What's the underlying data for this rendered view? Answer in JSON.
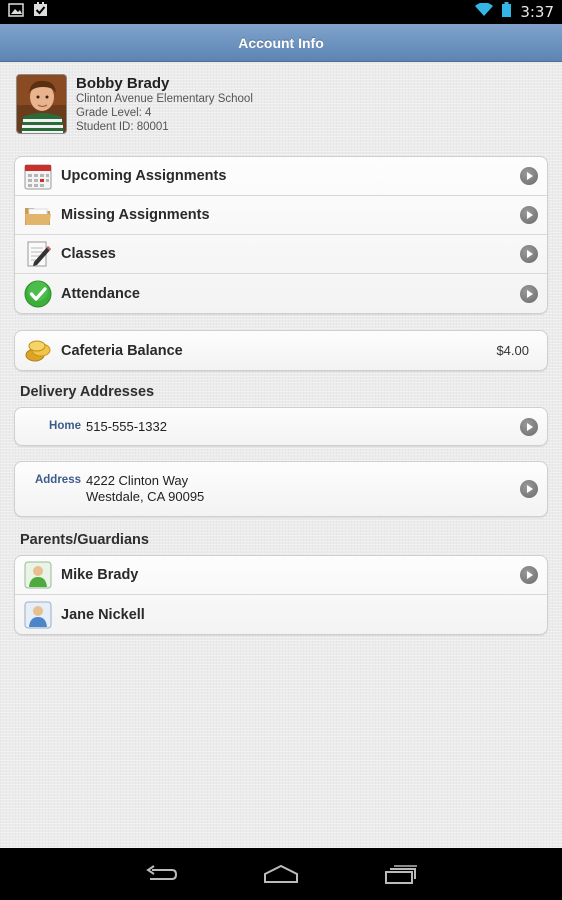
{
  "status_bar": {
    "time": "3:37",
    "left_icons": [
      "image-notification-icon",
      "checkbox-notification-icon"
    ],
    "right_icons": [
      "wifi-icon",
      "battery-icon"
    ]
  },
  "header": {
    "title": "Account Info"
  },
  "student": {
    "name": "Bobby Brady",
    "school": "Clinton Avenue Elementary School",
    "grade": "Grade Level: 4",
    "student_id": "Student ID: 80001"
  },
  "menu": {
    "items": [
      {
        "label": "Upcoming Assignments",
        "icon": "calendar-icon"
      },
      {
        "label": "Missing Assignments",
        "icon": "folder-icon"
      },
      {
        "label": "Classes",
        "icon": "notepad-pencil-icon"
      },
      {
        "label": "Attendance",
        "icon": "checkmark-icon"
      }
    ]
  },
  "cafeteria": {
    "label": "Cafeteria Balance",
    "value": "$4.00",
    "icon": "coins-icon"
  },
  "delivery": {
    "title": "Delivery Addresses",
    "phone": {
      "key": "Home",
      "value": "515-555-1332"
    },
    "address": {
      "key": "Address",
      "line1": "4222 Clinton Way",
      "line2": "Westdale, CA 90095"
    }
  },
  "parents": {
    "title": "Parents/Guardians",
    "items": [
      {
        "name": "Mike Brady",
        "icon": "person-green-icon",
        "has_chevron": true
      },
      {
        "name": "Jane Nickell",
        "icon": "person-blue-icon",
        "has_chevron": false
      }
    ]
  },
  "colors": {
    "header": "#6a8fbd",
    "label_blue": "#3d5b8b",
    "attendance_green": "#3cae3a"
  }
}
